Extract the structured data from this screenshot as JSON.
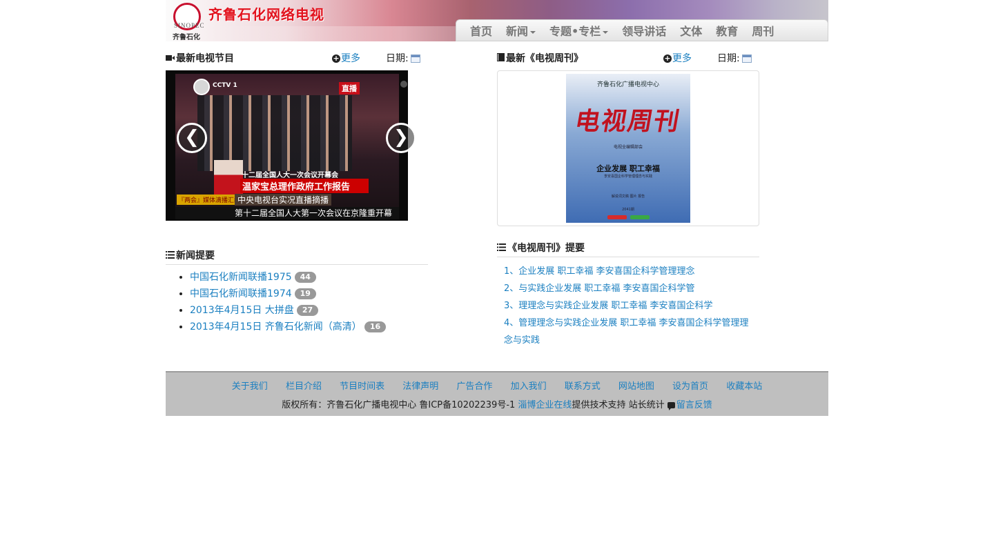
{
  "header": {
    "logo_text_en": "SINOPEC",
    "logo_text_cn": "齐鲁石化",
    "site_title": "齐鲁石化网络电视"
  },
  "nav": {
    "items": [
      {
        "label": "首页",
        "dropdown": false
      },
      {
        "label": "新闻",
        "dropdown": true
      },
      {
        "label": "专题•专栏",
        "dropdown": true
      },
      {
        "label": "领导讲话",
        "dropdown": false
      },
      {
        "label": "文体",
        "dropdown": false
      },
      {
        "label": "教育",
        "dropdown": false
      },
      {
        "label": "周刊",
        "dropdown": false
      }
    ]
  },
  "tv_section": {
    "title": "最新电视节目",
    "more": "更多",
    "date_label": "日期:",
    "video": {
      "channel": "CCTV 1",
      "live": "直播",
      "subtitle_top": "十二届全国人大一次会议开幕会",
      "subtitle_main": "温家宝总理作政府工作报告",
      "tag": "『两会』媒体滴播汇编",
      "subtitle_mid": "中央电视台实况直播摘播",
      "subtitle_bottom": "第十二届全国人大第一次会议在京隆重开幕"
    },
    "prev": "❮",
    "next": "❯"
  },
  "weekly_section": {
    "title": "最新《电视周刊》",
    "more": "更多",
    "date_label": "日期:",
    "cover": {
      "org": "齐鲁石化广播电视中心",
      "title": "电视周刊",
      "small": "电视全编辑部会",
      "theme": "企业发展 职工幸福",
      "theme_sub": "李安喜国企科学管理理念与实践",
      "meta": "解说词文稿  图片  报告",
      "issue": "2041期"
    }
  },
  "news_section": {
    "title": "新闻提要",
    "items": [
      {
        "label": "中国石化新闻联播1975",
        "count": "44"
      },
      {
        "label": "中国石化新闻联播1974",
        "count": "19"
      },
      {
        "label": "2013年4月15日 大拼盘",
        "count": "27"
      },
      {
        "label": "2013年4月15日 齐鲁石化新闻（高清）",
        "count": "16"
      }
    ]
  },
  "weekly_summary": {
    "title": "《电视周刊》提要",
    "items": [
      "1、企业发展 职工幸福 李安喜国企科学管理理念",
      "2、与实践企业发展 职工幸福 李安喜国企科学管",
      "3、理理念与实践企业发展 职工幸福 李安喜国企科学",
      "4、管理理念与实践企业发展 职工幸福 李安喜国企科学管理理念与实践"
    ]
  },
  "footer": {
    "links": [
      "关于我们",
      "栏目介绍",
      "节目时间表",
      "法律声明",
      "广告合作",
      "加入我们",
      "联系方式",
      "网站地图",
      "设为首页",
      "收藏本站"
    ],
    "copyright": "版权所有：齐鲁石化广播电视中心 鲁ICP备10202239号-1 ",
    "tech_link": "淄博企业在线",
    "tech_suffix": "提供技术支持 站长统计",
    "feedback": "留言反馈"
  },
  "colors": {
    "link": "#1a7fc0",
    "title_red": "#e2131e",
    "footer_bg": "#bfbfbf",
    "badge": "#999999"
  }
}
